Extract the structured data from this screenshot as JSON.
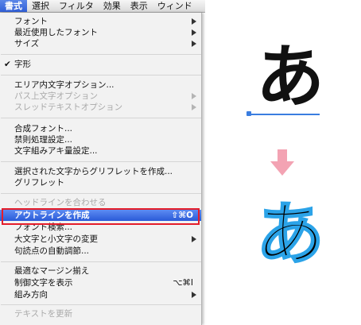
{
  "menubar": {
    "items": [
      "書式",
      "選択",
      "フィルタ",
      "効果",
      "表示",
      "ウィンド"
    ]
  },
  "menu": {
    "font": "フォント",
    "recent_font": "最近使用したフォント",
    "size": "サイズ",
    "glyph": "字形",
    "area_text_options": "エリア内文字オプション...",
    "path_text_options": "パス上文字オプション",
    "threaded_text_options": "スレッドテキストオプション",
    "composite_fonts": "合成フォント...",
    "kinsoku_settings": "禁則処理設定...",
    "mojikumi_settings": "文字組みアキ量設定...",
    "create_glyphlet": "選択された文字からグリフレットを作成...",
    "glyphlet": "グリフレット",
    "fit_headline": "ヘッドラインを合わせる",
    "create_outlines": "アウトラインを作成",
    "create_outlines_shortcut": "⇧⌘O",
    "find_font": "フォント検索...",
    "change_case": "大文字と小文字の変更",
    "smart_punctuation": "句読点の自動調節...",
    "optical_margin": "最適なマージン揃え",
    "show_hidden_chars": "制御文字を表示",
    "show_hidden_chars_shortcut": "⌥⌘I",
    "type_orientation": "組み方向",
    "update_legacy_text": "テキストを更新"
  },
  "illustration": {
    "char_before": "あ",
    "char_after": "あ",
    "arrow_color": "#f3a3b3",
    "outline_color": "#2ba3e8"
  }
}
